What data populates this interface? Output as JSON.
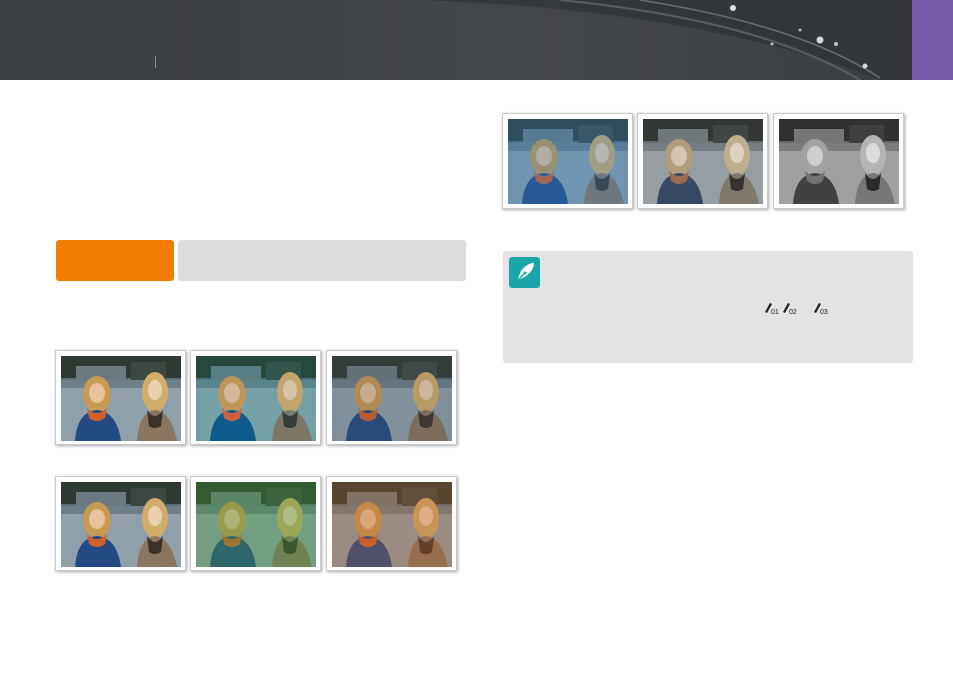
{
  "header": {
    "accent_color": "#7658a9",
    "background_color": "#3f4246"
  },
  "tabs": {
    "active_color": "#f07c00",
    "inactive_color": "#dcdcdc"
  },
  "photo_grid_left": {
    "rows": [
      [
        {
          "tint": "normal"
        },
        {
          "tint": "cool"
        },
        {
          "tint": "muted"
        }
      ],
      [
        {
          "tint": "normal"
        },
        {
          "tint": "green"
        },
        {
          "tint": "warm"
        }
      ]
    ]
  },
  "photo_strip_right": [
    {
      "tint": "blue"
    },
    {
      "tint": "desaturated"
    },
    {
      "tint": "monochrome"
    }
  ],
  "note": {
    "icon": "pen-nib-icon",
    "icon_color": "#1aa6a8",
    "background_color": "#e3e3e3",
    "mode_icons": [
      {
        "icon": "picture-wizard-icon",
        "label": "01"
      },
      {
        "icon": "picture-wizard-icon",
        "label": "02"
      },
      {
        "icon": "picture-wizard-icon",
        "label": "03"
      }
    ]
  }
}
